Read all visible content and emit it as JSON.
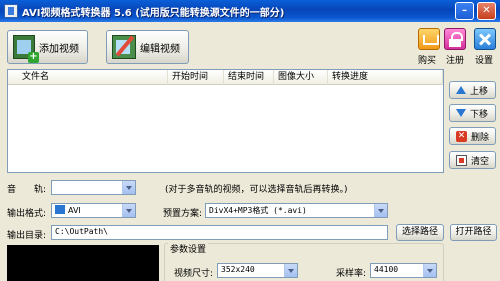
{
  "window": {
    "title": "AVI视频格式转换器 5.6 (试用版只能转换源文件的一部分)",
    "min_glyph": "–",
    "close_glyph": "✕"
  },
  "toolbar": {
    "add_video": "添加视频",
    "add_icon": "film-add-icon",
    "edit_video": "编辑视频",
    "edit_icon": "film-edit-icon",
    "buy": "购买",
    "register": "注册",
    "settings": "设置"
  },
  "file_list": {
    "columns": [
      "文件名",
      "开始时间",
      "结束时间",
      "图像大小",
      "转换进度"
    ],
    "rows": []
  },
  "side_buttons": {
    "move_up": "上移",
    "move_down": "下移",
    "delete": "删除",
    "clear": "清空"
  },
  "audio_track": {
    "label": "音　　轨:",
    "value": "",
    "hint": "(对于多音轨的视频，可以选择音轨后再转换。)"
  },
  "output_format": {
    "label": "输出格式:",
    "value": "AVI"
  },
  "preset": {
    "label": "预置方案:",
    "value": "DivX4+MP3格式 (*.avi)"
  },
  "output_dir": {
    "label": "输出目录:",
    "value": "C:\\OutPath\\",
    "choose_button": "选择路径",
    "open_button": "打开路径"
  },
  "params": {
    "title": "参数设置",
    "video_size_label": "视频尺寸:",
    "video_size_value": "352x240",
    "sample_rate_label": "采样率:",
    "sample_rate_value": "44100"
  },
  "colors": {
    "title_bar": "#0a5fd8",
    "window_bg": "#ece9d8",
    "border": "#7f9db9",
    "accent": "#2a76d0"
  }
}
